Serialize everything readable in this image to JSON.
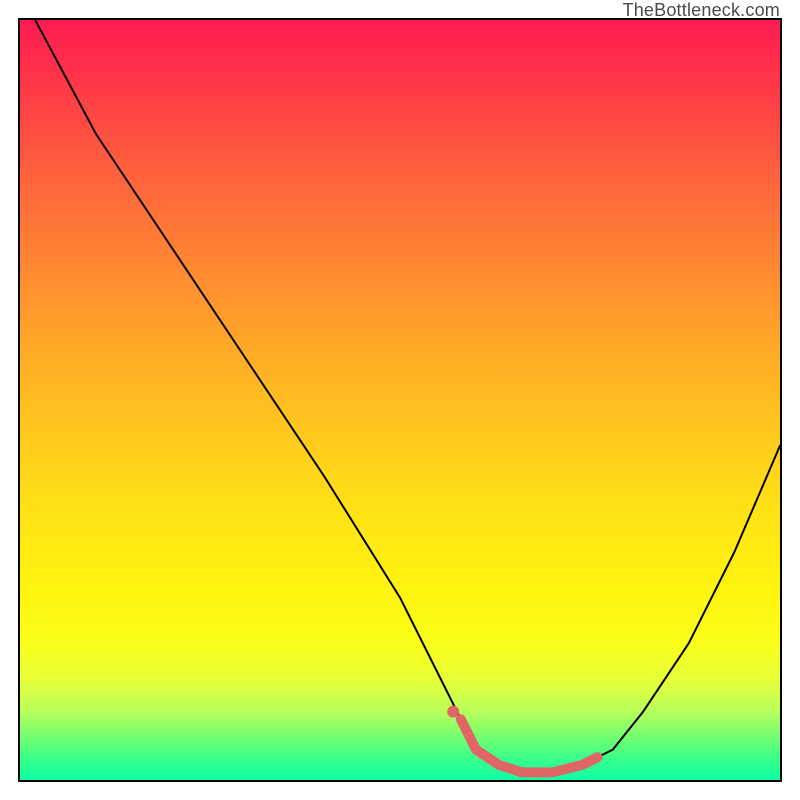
{
  "watermark": "TheBottleneck.com",
  "chart_data": {
    "type": "line",
    "title": "",
    "xlabel": "",
    "ylabel": "",
    "xlim": [
      0,
      100
    ],
    "ylim": [
      0,
      100
    ],
    "series": [
      {
        "name": "curve",
        "x": [
          2,
          10,
          20,
          30,
          40,
          50,
          55,
          58,
          60,
          63,
          66,
          70,
          74,
          78,
          82,
          88,
          94,
          100
        ],
        "values": [
          100,
          85,
          70,
          55,
          40,
          24,
          14,
          8,
          4,
          2,
          1,
          1,
          2,
          4,
          9,
          18,
          30,
          44
        ],
        "color": "#000000",
        "stroke_width": 2
      },
      {
        "name": "highlight",
        "x": [
          58,
          60,
          63,
          66,
          70,
          74,
          76
        ],
        "values": [
          8,
          4,
          2,
          1,
          1,
          2,
          3
        ],
        "color": "#e06666",
        "stroke_width": 10
      }
    ],
    "markers": [
      {
        "x": 57,
        "y": 9,
        "color": "#e06666",
        "radius": 6
      }
    ],
    "background_gradient": {
      "direction": "vertical",
      "stops": [
        {
          "pos": 0.0,
          "color": "#ff1a52"
        },
        {
          "pos": 0.5,
          "color": "#ffd21e"
        },
        {
          "pos": 0.82,
          "color": "#fbff1a"
        },
        {
          "pos": 1.0,
          "color": "#10ffa5"
        }
      ]
    }
  }
}
